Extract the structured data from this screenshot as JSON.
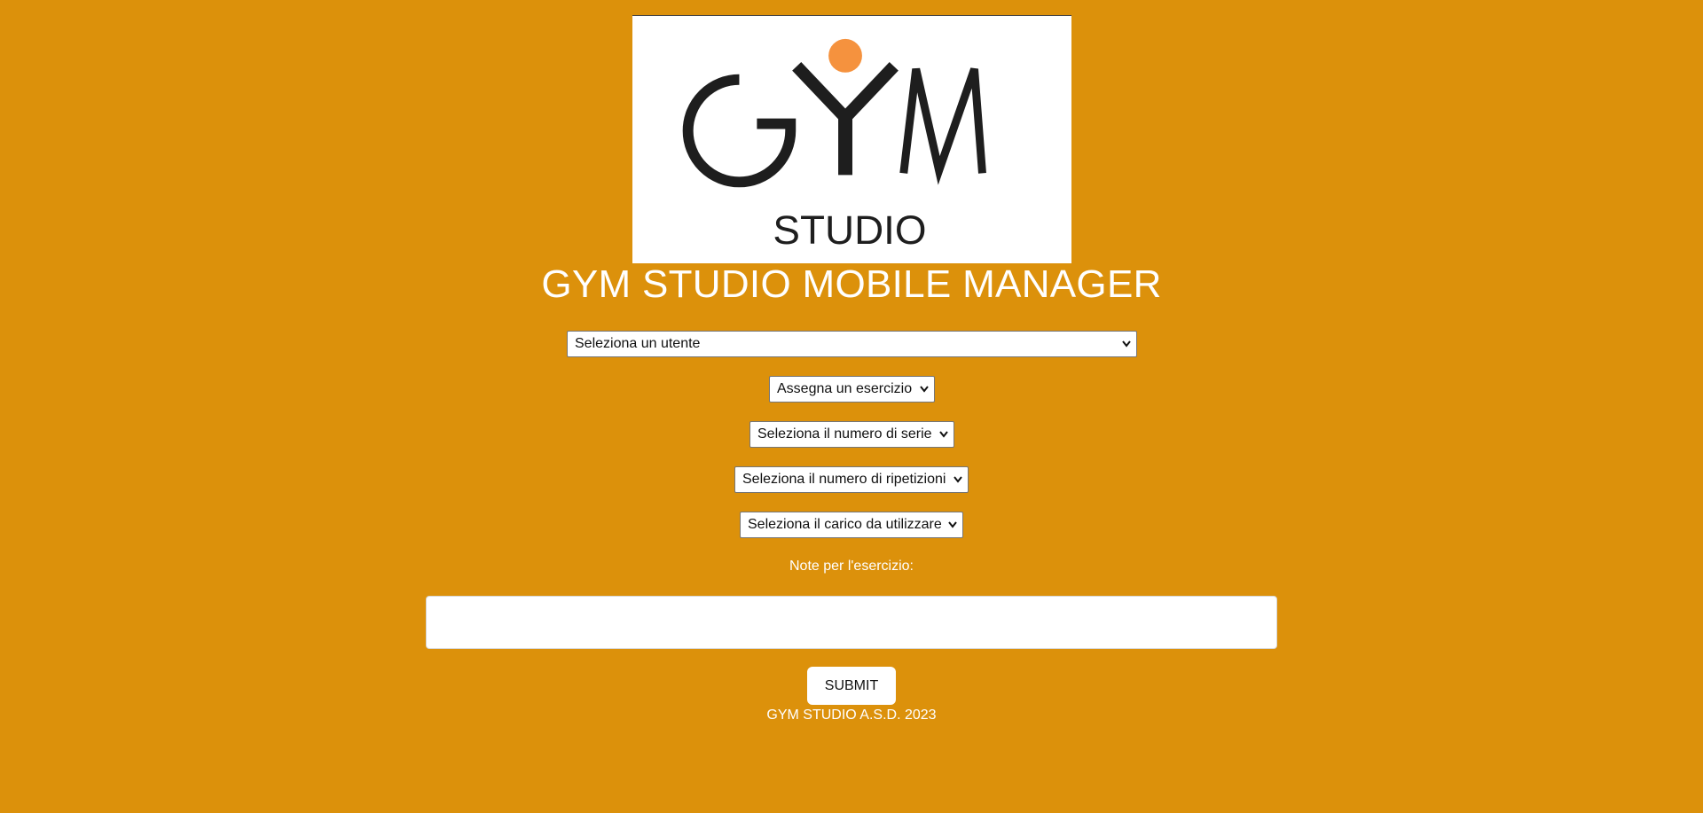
{
  "logo": {
    "primary_text": "GYM",
    "secondary_text": "STUDIO",
    "accent_color": "#f5923e",
    "text_color": "#1e1e1e"
  },
  "header": {
    "title": "GYM STUDIO MOBILE MANAGER"
  },
  "form": {
    "user_select": {
      "selected": "Seleziona un utente"
    },
    "exercise_select": {
      "selected": "Assegna un esercizio"
    },
    "series_select": {
      "selected": "Seleziona il numero di serie"
    },
    "reps_select": {
      "selected": "Seleziona il numero di ripetizioni"
    },
    "load_select": {
      "selected": "Seleziona il carico da utilizzare"
    },
    "notes_label": "Note per l'esercizio:",
    "notes_value": "",
    "submit_label": "SUBMIT"
  },
  "footer": {
    "text": "GYM STUDIO A.S.D. 2023"
  },
  "colors": {
    "background": "#dc910b",
    "foreground": "#ffffff"
  }
}
